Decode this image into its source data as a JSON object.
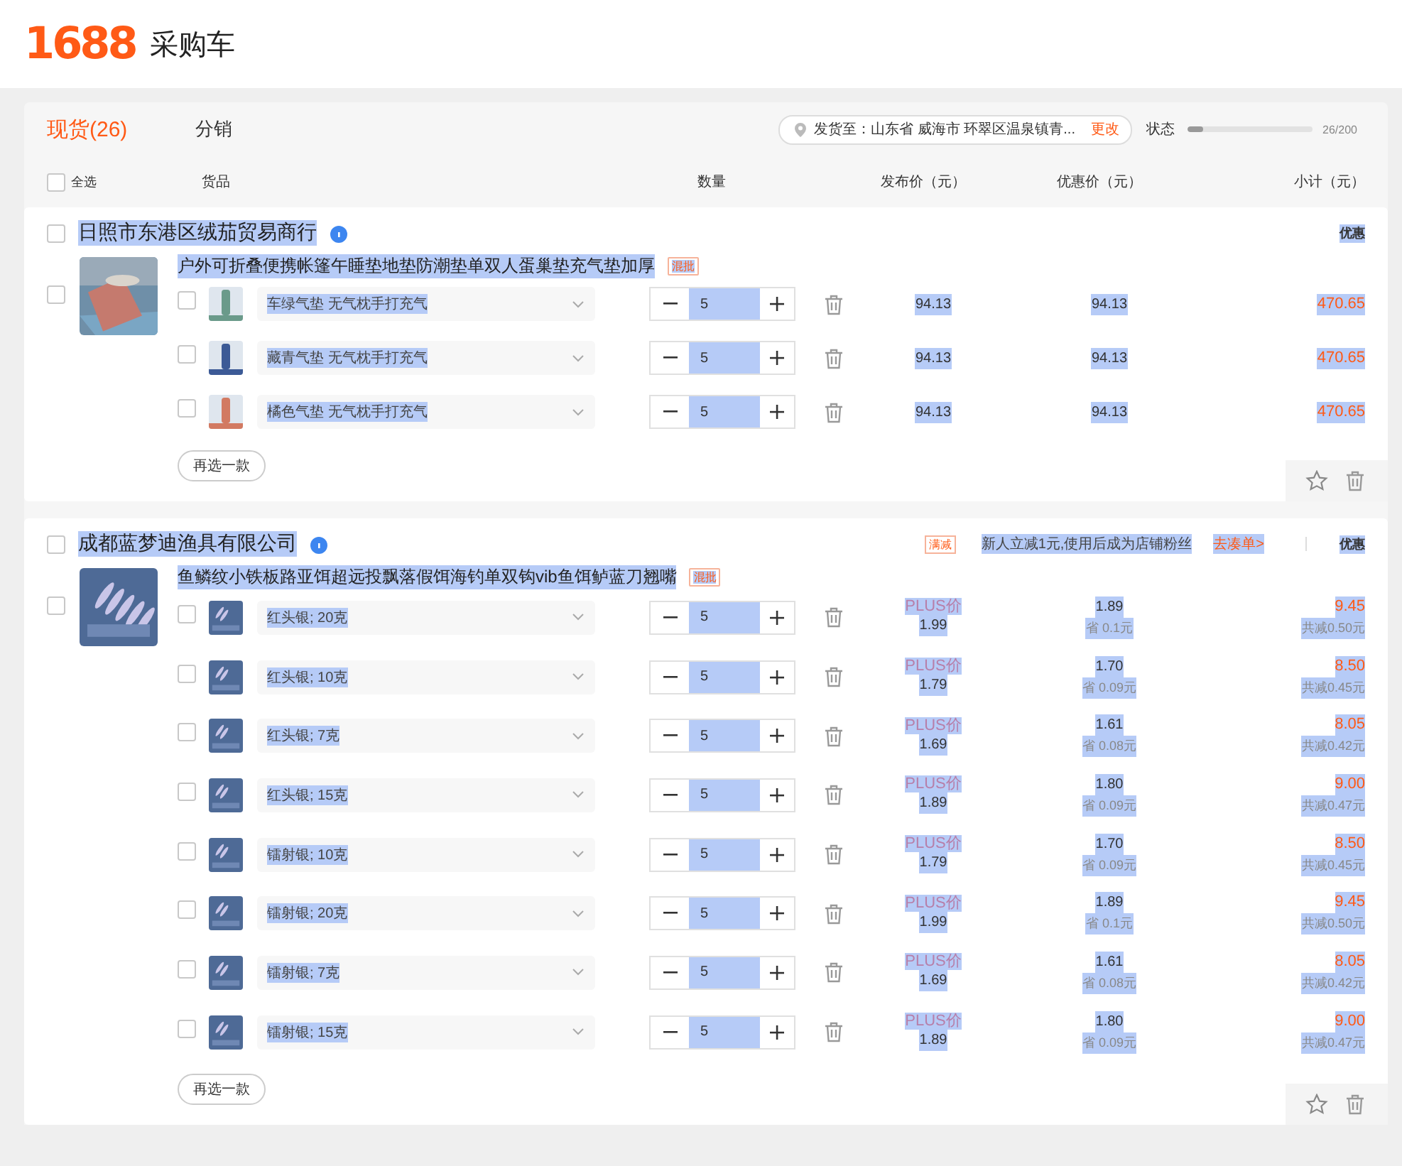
{
  "header": {
    "logo": "1688",
    "title": "采购车"
  },
  "text_selection": true,
  "tabs": [
    {
      "label": "现货(26)",
      "selected": true
    },
    {
      "label": "分销",
      "selected": false
    }
  ],
  "shipping": {
    "label": "发货至：山东省 威海市 环翠区温泉镇青...",
    "action": "更改"
  },
  "status": {
    "label": "状态",
    "level": 0.13,
    "reading": "26/200"
  },
  "select_all": {
    "label": "全选",
    "checked": false
  },
  "columns": [
    "货品",
    "数量",
    "发布价（元）",
    "优惠价（元）",
    "小计（元）"
  ],
  "shops": [
    {
      "name": "日照市东港区绒茄贸易商行",
      "checked": false,
      "discount_label": "优惠",
      "reselect": "再选一款",
      "products": [
        {
          "title": "户外可折叠便携帐篷午睡垫地垫防潮垫单双人蛋巢垫充气垫加厚",
          "tag": "混批",
          "checked": false,
          "skus": [
            {
              "spec": "车绿气垫 无气枕手打充气",
              "checked": false,
              "quantity": "5",
              "publish_price": "94.13",
              "discount_price": "94.13",
              "subtotal": "470.65"
            },
            {
              "spec": "藏青气垫 无气枕手打充气",
              "checked": false,
              "quantity": "5",
              "publish_price": "94.13",
              "discount_price": "94.13",
              "subtotal": "470.65"
            },
            {
              "spec": "橘色气垫 无气枕手打充气",
              "checked": false,
              "quantity": "5",
              "publish_price": "94.13",
              "discount_price": "94.13",
              "subtotal": "470.65"
            }
          ]
        }
      ]
    },
    {
      "name": "成都蓝梦迪渔具有限公司",
      "checked": false,
      "promo": {
        "tag": "满减",
        "text": "新人立减1元,使用后成为店铺粉丝",
        "link": "去凑单>"
      },
      "discount_label": "优惠",
      "reselect": "再选一款",
      "products": [
        {
          "title": "鱼鳞纹小铁板路亚饵超远投飘落假饵海钓单双钩vib鱼饵鲈蓝刀翘嘴",
          "tag": "混批",
          "checked": false,
          "skus": [
            {
              "spec": "红头银; 20克",
              "checked": false,
              "quantity": "5",
              "price_label": "PLUS价",
              "publish_price": "1.99",
              "discount_price": "1.89",
              "saving": "省 0.1元",
              "subtotal": "9.45",
              "total_saving": "共减0.50元"
            },
            {
              "spec": "红头银; 10克",
              "checked": false,
              "quantity": "5",
              "price_label": "PLUS价",
              "publish_price": "1.79",
              "discount_price": "1.70",
              "saving": "省 0.09元",
              "subtotal": "8.50",
              "total_saving": "共减0.45元"
            },
            {
              "spec": "红头银; 7克",
              "checked": false,
              "quantity": "5",
              "price_label": "PLUS价",
              "publish_price": "1.69",
              "discount_price": "1.61",
              "saving": "省 0.08元",
              "subtotal": "8.05",
              "total_saving": "共减0.42元"
            },
            {
              "spec": "红头银; 15克",
              "checked": false,
              "quantity": "5",
              "price_label": "PLUS价",
              "publish_price": "1.89",
              "discount_price": "1.80",
              "saving": "省 0.09元",
              "subtotal": "9.00",
              "total_saving": "共减0.47元"
            },
            {
              "spec": "镭射银; 10克",
              "checked": false,
              "quantity": "5",
              "price_label": "PLUS价",
              "publish_price": "1.79",
              "discount_price": "1.70",
              "saving": "省 0.09元",
              "subtotal": "8.50",
              "total_saving": "共减0.45元"
            },
            {
              "spec": "镭射银; 20克",
              "checked": false,
              "quantity": "5",
              "price_label": "PLUS价",
              "publish_price": "1.99",
              "discount_price": "1.89",
              "saving": "省 0.1元",
              "subtotal": "9.45",
              "total_saving": "共减0.50元"
            },
            {
              "spec": "镭射银; 7克",
              "checked": false,
              "quantity": "5",
              "price_label": "PLUS价",
              "publish_price": "1.69",
              "discount_price": "1.61",
              "saving": "省 0.08元",
              "subtotal": "8.05",
              "total_saving": "共减0.42元"
            },
            {
              "spec": "镭射银; 15克",
              "checked": false,
              "quantity": "5",
              "price_label": "PLUS价",
              "publish_price": "1.89",
              "discount_price": "1.80",
              "saving": "省 0.09元",
              "subtotal": "9.00",
              "total_saving": "共减0.47元"
            }
          ]
        }
      ]
    }
  ]
}
